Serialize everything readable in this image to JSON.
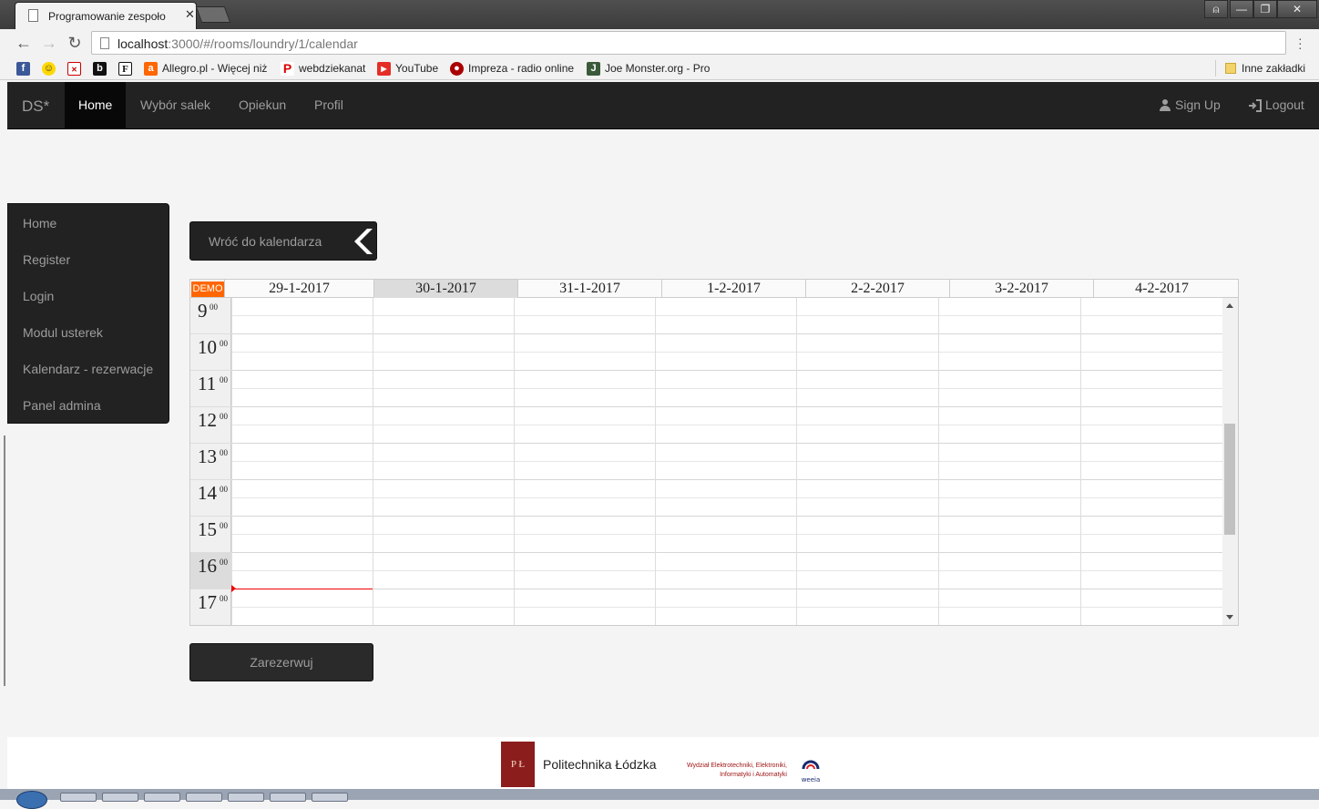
{
  "browser": {
    "tab_title": "Programowanie zespoło",
    "tab_close": "✕",
    "window_controls": [
      "⍝",
      "—",
      "❐",
      "✕"
    ],
    "url_host": "localhost",
    "url_rest": ":3000/#/rooms/loundry/1/calendar",
    "bookmarks": [
      {
        "label": "",
        "icon": "facebook-icon"
      },
      {
        "label": "",
        "icon": "smiley-icon"
      },
      {
        "label": "",
        "icon": "red-sign-icon"
      },
      {
        "label": "",
        "icon": "pink-b-icon"
      },
      {
        "label": "",
        "icon": "f-icon"
      },
      {
        "label": "Allegro.pl - Więcej niż",
        "icon": "allegro-icon"
      },
      {
        "label": "webdziekanat",
        "icon": "p-icon"
      },
      {
        "label": "YouTube",
        "icon": "youtube-icon"
      },
      {
        "label": "Impreza - radio online",
        "icon": "radio-icon"
      },
      {
        "label": "Joe Monster.org - Pro",
        "icon": "joemonster-icon"
      }
    ],
    "other_bookmarks": "Inne zakładki"
  },
  "navbar": {
    "brand": "DS*",
    "items": [
      {
        "label": "Home",
        "active": true
      },
      {
        "label": "Wybór salek",
        "active": false
      },
      {
        "label": "Opiekun",
        "active": false
      },
      {
        "label": "Profil",
        "active": false
      }
    ],
    "sign_up": "Sign Up",
    "logout": "Logout"
  },
  "sidebar": {
    "items": [
      {
        "label": "Home"
      },
      {
        "label": "Register"
      },
      {
        "label": "Login"
      },
      {
        "label": "Modul usterek"
      },
      {
        "label": "Kalendarz - rezerwacje"
      },
      {
        "label": "Panel admina"
      }
    ]
  },
  "back_button": {
    "label": "Wróć do kalendarza"
  },
  "calendar": {
    "demo_badge": "DEMO",
    "days": [
      "29-1-2017",
      "30-1-2017",
      "31-1-2017",
      "1-2-2017",
      "2-2-2017",
      "3-2-2017",
      "4-2-2017"
    ],
    "today": "30-1-2017",
    "hours": [
      "9",
      "10",
      "11",
      "12",
      "13",
      "14",
      "15",
      "16",
      "17"
    ],
    "minutes": "00",
    "current_hour": "16"
  },
  "reserve_button": {
    "label": "Zarezerwuj"
  },
  "footer": {
    "university_logo_text": "P Ł",
    "university": "Politechnika Łódzka",
    "faculty": "Wydział Elektrotechniki, Elektroniki, Informatyki i Automatyki",
    "weeia": "weeia"
  },
  "colors": {
    "navbar_bg": "#222222",
    "accent_demo": "#ff6600",
    "now_line": "#ee0000",
    "footer_logo": "#8c1d1d"
  }
}
